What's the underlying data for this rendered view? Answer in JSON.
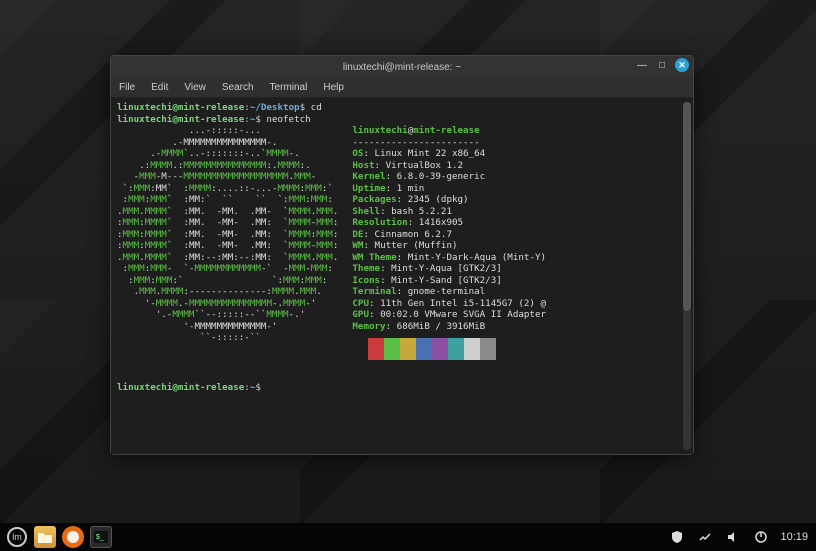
{
  "window": {
    "title": "linuxtechi@mint-release: ~"
  },
  "menu": {
    "file": "File",
    "edit": "Edit",
    "view": "View",
    "search": "Search",
    "terminal": "Terminal",
    "help": "Help"
  },
  "prompt1": {
    "user": "linuxtechi@mint-release",
    "colon": ":",
    "path": "~/Desktop",
    "sym": "$",
    "cmd": "cd"
  },
  "prompt2": {
    "user": "linuxtechi@mint-release",
    "colon": ":",
    "path": "~",
    "sym": "$",
    "cmd": "neofetch"
  },
  "ascii": [
    "             ...-:::::-...",
    "          .-MMMMMMMMMMMMMMM-.",
    "      .-MMMM`..-:::::::-..`MMMM-.",
    "    .:MMMM.:MMMMMMMMMMMMMMM:.MMMM:.",
    "   -MMM-M---MMMMMMMMMMMMMMMMMMM.MMM-",
    " `:MMM:MM`  :MMMM:....::-...-MMMM:MMM:`",
    " :MMM:MMM`  :MM:`  ``    ``  `:MMM:MMM:",
    ".MMM.MMMM`  :MM.  -MM.  .MM-  `MMMM.MMM.",
    ":MMM:MMMM`  :MM.  -MM-  .MM:  `MMMM-MMM:",
    ":MMM:MMMM`  :MM.  -MM-  .MM:  `MMMM:MMM:",
    ":MMM:MMMM`  :MM.  -MM-  .MM:  `MMMM-MMM:",
    ".MMM.MMMM`  :MM:--:MM:--:MM:  `MMMM.MMM.",
    " :MMM:MMM-  `-MMMMMMMMMMMM-`  -MMM-MMM:",
    "  :MMM:MMM:`                `:MMM:MMM:",
    "   .MMM.MMMM:--------------:MMMM.MMM.",
    "     '-MMMM.-MMMMMMMMMMMMMMM-.MMMM-'",
    "       '.-MMMM``--:::::--``MMMM-.'",
    "            '-MMMMMMMMMMMMM-'",
    "               ``-:::::-``"
  ],
  "info": {
    "header_user": "linuxtechi",
    "header_at": "@",
    "header_host": "mint-release",
    "dash": "-----------------------",
    "rows": [
      {
        "k": "OS",
        "v": "Linux Mint 22 x86_64"
      },
      {
        "k": "Host",
        "v": "VirtualBox 1.2"
      },
      {
        "k": "Kernel",
        "v": "6.8.0-39-generic"
      },
      {
        "k": "Uptime",
        "v": "1 min"
      },
      {
        "k": "Packages",
        "v": "2345 (dpkg)"
      },
      {
        "k": "Shell",
        "v": "bash 5.2.21"
      },
      {
        "k": "Resolution",
        "v": "1416x905"
      },
      {
        "k": "DE",
        "v": "Cinnamon 6.2.7"
      },
      {
        "k": "WM",
        "v": "Mutter (Muffin)"
      },
      {
        "k": "WM Theme",
        "v": "Mint-Y-Dark-Aqua (Mint-Y)"
      },
      {
        "k": "Theme",
        "v": "Mint-Y-Aqua [GTK2/3]"
      },
      {
        "k": "Icons",
        "v": "Mint-Y-Sand [GTK2/3]"
      },
      {
        "k": "Terminal",
        "v": "gnome-terminal"
      },
      {
        "k": "CPU",
        "v": "11th Gen Intel i5-1145G7 (2) @"
      },
      {
        "k": "GPU",
        "v": "00:02.0 VMware SVGA II Adapter"
      },
      {
        "k": "Memory",
        "v": "686MiB / 3916MiB"
      }
    ],
    "colors": [
      "#1e1e1e",
      "#cc3b3b",
      "#5bbf47",
      "#c6a83d",
      "#4a6fb3",
      "#8a4fa0",
      "#3fa0a0",
      "#cfcfcf",
      "#8a8a8a"
    ]
  },
  "prompt3": {
    "user": "linuxtechi@mint-release",
    "colon": ":",
    "path": "~",
    "sym": "$",
    "cmd": ""
  },
  "taskbar": {
    "clock": "10:19"
  }
}
